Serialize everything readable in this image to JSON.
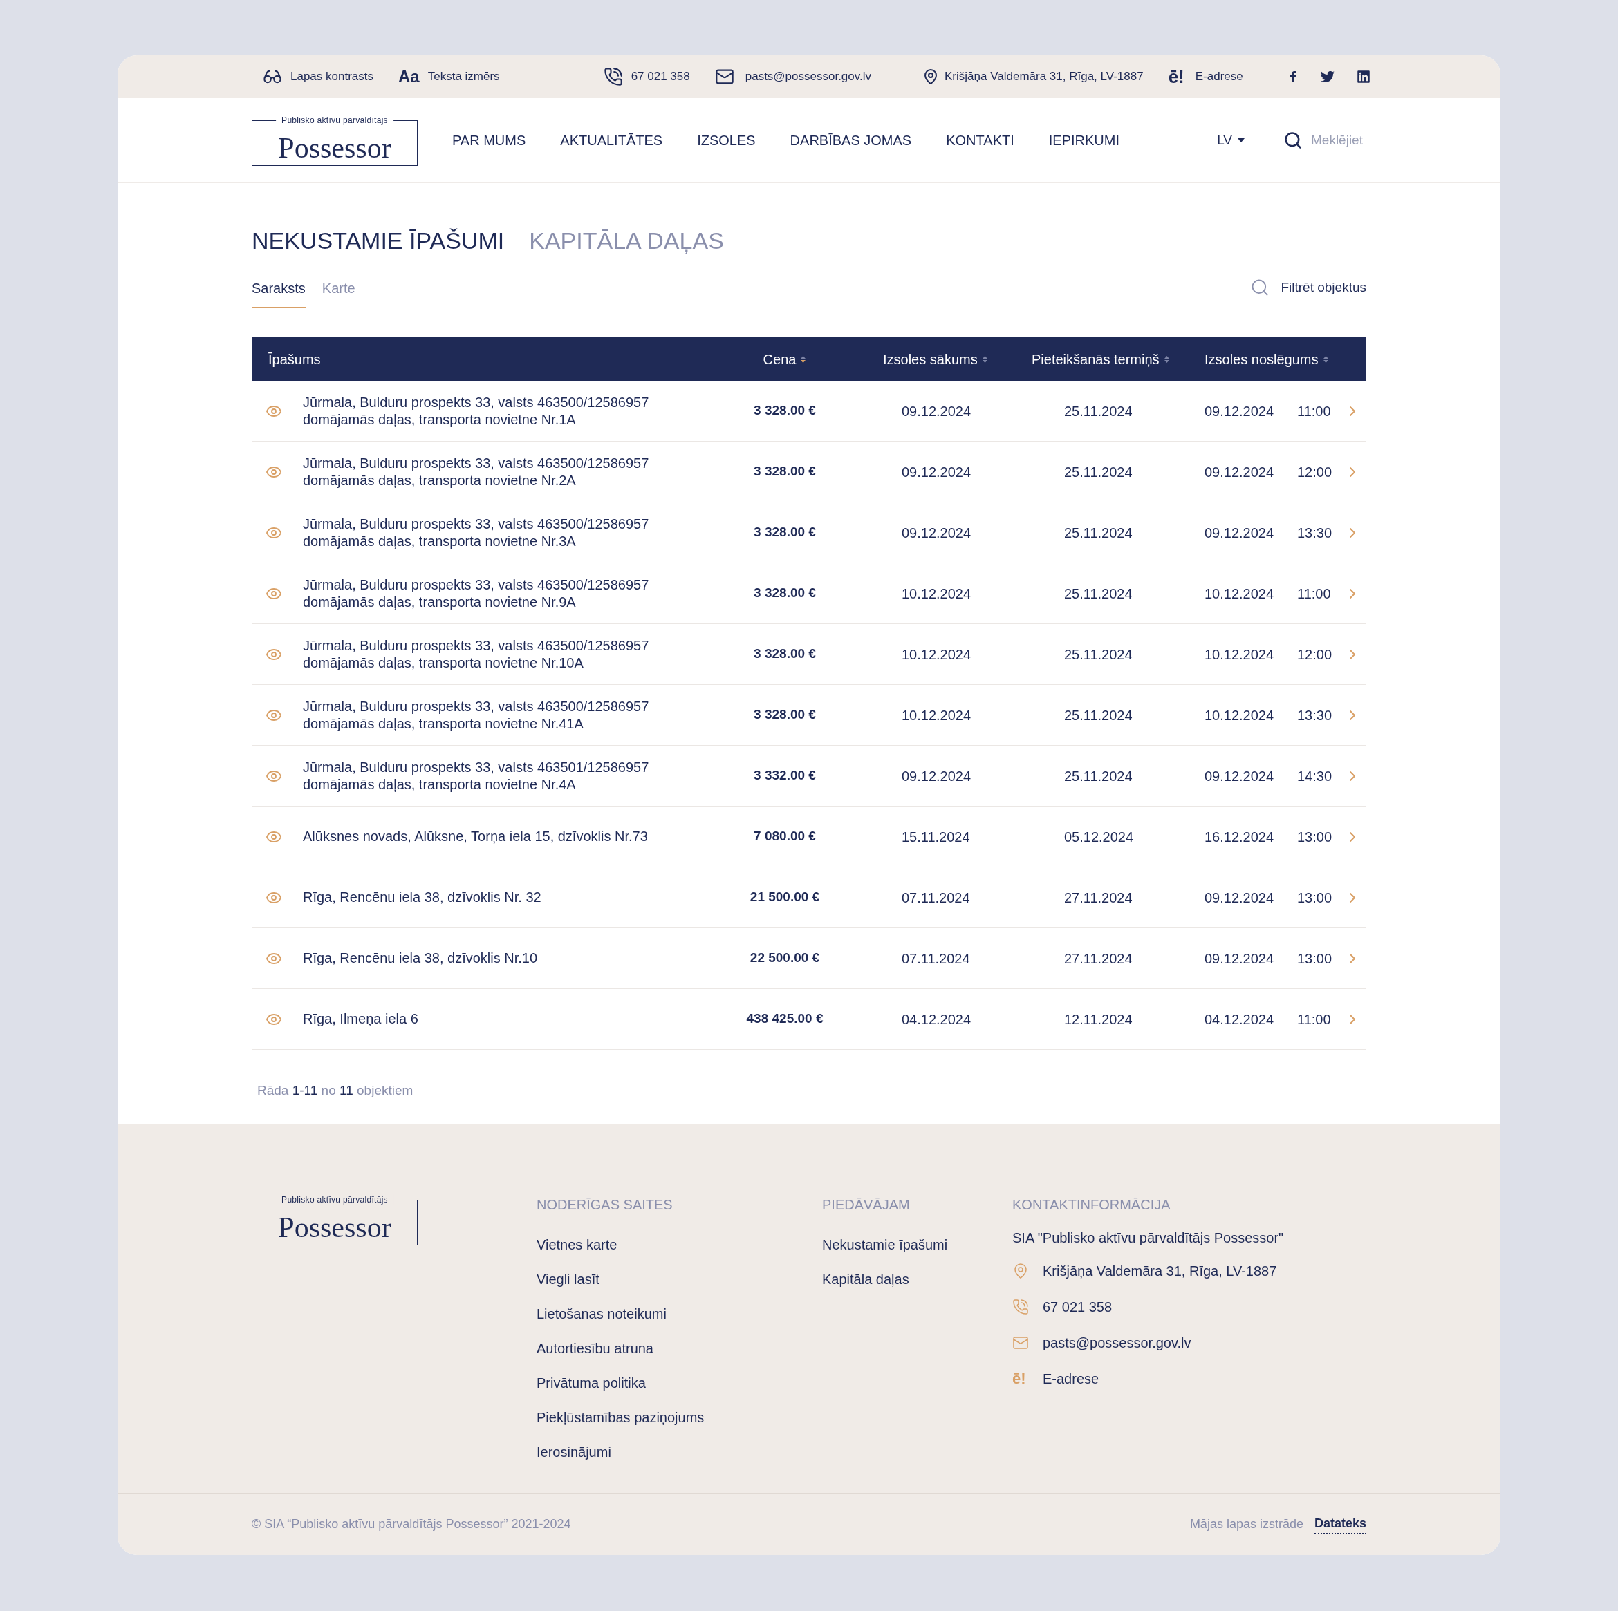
{
  "top_bar": {
    "contrast": "Lapas kontrasts",
    "text_size_icon": "Aa",
    "text_size": "Teksta izmērs",
    "phone": "67 021 358",
    "email": "pasts@possessor.gov.lv",
    "address": "Krišjāņa Valdemāra 31, Rīga, LV-1887",
    "eaddress_icon": "ē!",
    "eaddress": "E-adrese"
  },
  "logo": {
    "tagline": "Publisko aktīvu pārvaldītājs",
    "name": "Possessor"
  },
  "nav": [
    "PAR MUMS",
    "AKTUALITĀTES",
    "IZSOLES",
    "DARBĪBAS JOMAS",
    "KONTAKTI",
    "IEPIRKUMI"
  ],
  "language": "LV",
  "search": {
    "placeholder": "Meklējiet"
  },
  "section_tabs": [
    {
      "label": "NEKUSTAMIE ĪPAŠUMI",
      "selected": true
    },
    {
      "label": "KAPITĀLA DAĻAS",
      "selected": false
    }
  ],
  "view_tabs": [
    {
      "label": "Saraksts",
      "selected": true
    },
    {
      "label": "Karte",
      "selected": false
    }
  ],
  "filter": "Filtrēt objektus",
  "table": {
    "columns": [
      {
        "label": "Īpašums"
      },
      {
        "label": "Cena",
        "sorted": true
      },
      {
        "label": "Izsoles sākums",
        "sorted": false
      },
      {
        "label": "Pieteikšanās termiņš",
        "sorted": false
      },
      {
        "label": "Izsoles noslēgums",
        "sorted": false
      }
    ],
    "rows": [
      {
        "property": "Jūrmala, Bulduru prospekts 33, valsts 463500/12586957 domājamās daļas, transporta novietne Nr.1A",
        "price": "3 328.00 €",
        "start": "09.12.2024",
        "deadline": "25.11.2024",
        "end_date": "09.12.2024",
        "end_time": "11:00"
      },
      {
        "property": "Jūrmala, Bulduru prospekts 33, valsts 463500/12586957 domājamās daļas, transporta novietne Nr.2A",
        "price": "3 328.00 €",
        "start": "09.12.2024",
        "deadline": "25.11.2024",
        "end_date": "09.12.2024",
        "end_time": "12:00"
      },
      {
        "property": "Jūrmala, Bulduru prospekts 33, valsts 463500/12586957 domājamās daļas, transporta novietne Nr.3A",
        "price": "3 328.00 €",
        "start": "09.12.2024",
        "deadline": "25.11.2024",
        "end_date": "09.12.2024",
        "end_time": "13:30"
      },
      {
        "property": "Jūrmala, Bulduru prospekts 33, valsts 463500/12586957 domājamās daļas, transporta novietne Nr.9A",
        "price": "3 328.00 €",
        "start": "10.12.2024",
        "deadline": "25.11.2024",
        "end_date": "10.12.2024",
        "end_time": "11:00"
      },
      {
        "property": "Jūrmala, Bulduru prospekts 33, valsts 463500/12586957 domājamās daļas, transporta novietne Nr.10A",
        "price": "3 328.00 €",
        "start": "10.12.2024",
        "deadline": "25.11.2024",
        "end_date": "10.12.2024",
        "end_time": "12:00"
      },
      {
        "property": "Jūrmala, Bulduru prospekts 33, valsts 463500/12586957 domājamās daļas, transporta novietne Nr.41A",
        "price": "3 328.00 €",
        "start": "10.12.2024",
        "deadline": "25.11.2024",
        "end_date": "10.12.2024",
        "end_time": "13:30"
      },
      {
        "property": "Jūrmala, Bulduru prospekts 33, valsts 463501/12586957 domājamās daļas, transporta novietne Nr.4A",
        "price": "3 332.00 €",
        "start": "09.12.2024",
        "deadline": "25.11.2024",
        "end_date": "09.12.2024",
        "end_time": "14:30"
      },
      {
        "property": "Alūksnes novads, Alūksne, Torņa iela 15, dzīvoklis Nr.73",
        "price": "7 080.00 €",
        "start": "15.11.2024",
        "deadline": "05.12.2024",
        "end_date": "16.12.2024",
        "end_time": "13:00"
      },
      {
        "property": "Rīga, Rencēnu iela 38, dzīvoklis Nr. 32",
        "price": "21 500.00 €",
        "start": "07.11.2024",
        "deadline": "27.11.2024",
        "end_date": "09.12.2024",
        "end_time": "13:00"
      },
      {
        "property": "Rīga, Rencēnu iela 38, dzīvoklis Nr.10",
        "price": "22 500.00 €",
        "start": "07.11.2024",
        "deadline": "27.11.2024",
        "end_date": "09.12.2024",
        "end_time": "13:00"
      },
      {
        "property": "Rīga, Ilmeņa iela 6",
        "price": "438 425.00 €",
        "start": "04.12.2024",
        "deadline": "12.11.2024",
        "end_date": "04.12.2024",
        "end_time": "11:00"
      }
    ]
  },
  "result_count": "Rāda **1-11** no **11** objektiem",
  "footer": {
    "logo": {
      "tagline": "Publisko aktīvu pārvaldītājs",
      "name": "Possessor"
    },
    "links_title": "NODERĪGAS SAITES",
    "links": [
      "Vietnes karte",
      "Viegli lasīt",
      "Lietošanas noteikumi",
      "Autortiesību atruna",
      "Privātuma politika",
      "Piekļūstamības paziņojums",
      "Ierosinājumi"
    ],
    "offer_title": "PIEDĀVĀJAM",
    "offers": [
      "Nekustamie īpašumi",
      "Kapitāla daļas"
    ],
    "contact_title": "KONTAKTINFORMĀCIJA",
    "company": "SIA \"Publisko aktīvu pārvaldītājs Possessor\"",
    "contacts": [
      {
        "kind": "address",
        "text": "Krišjāņa Valdemāra 31, Rīga, LV-1887"
      },
      {
        "kind": "phone",
        "text": "67 021 358"
      },
      {
        "kind": "email",
        "text": "pasts@possessor.gov.lv"
      },
      {
        "kind": "eaddress",
        "icon": "ē!",
        "text": "E-adrese"
      }
    ],
    "copyright": "© SIA “Publisko aktīvu pārvaldītājs Possessor” 2021-2024",
    "made_by": "Mājas lapas izstrāde",
    "developer": "Datateks"
  }
}
